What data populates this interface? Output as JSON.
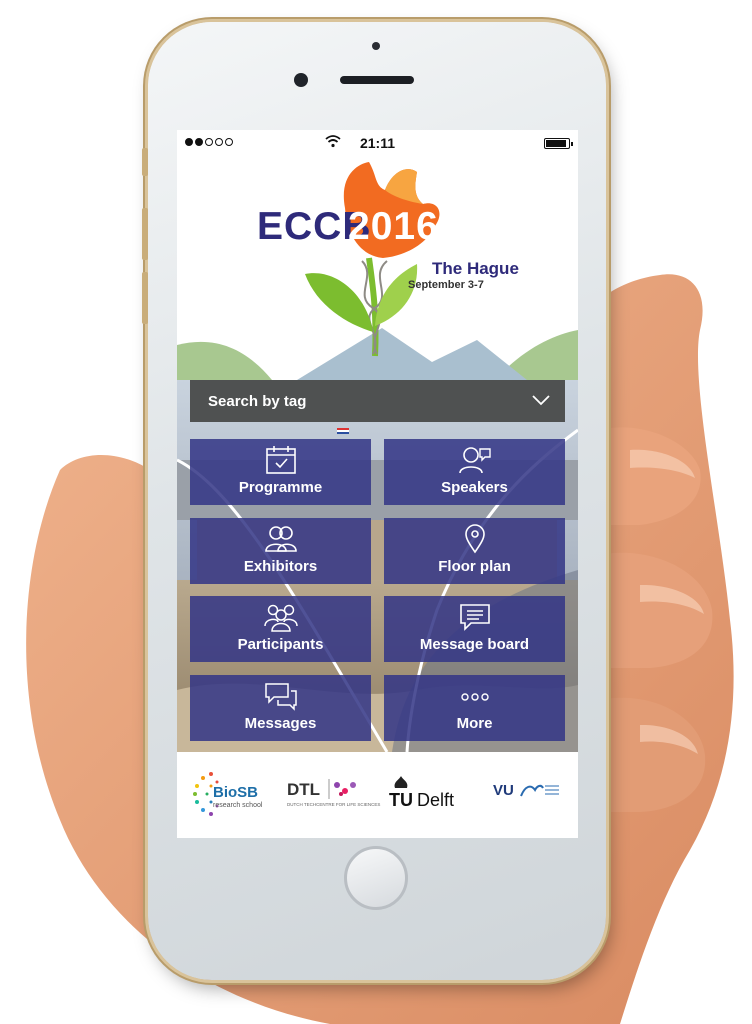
{
  "status_bar": {
    "time": "21:11"
  },
  "event": {
    "name": "ECCB",
    "year": "2016",
    "city": "The Hague",
    "dates": "September 3-7"
  },
  "search": {
    "label": "Search by tag"
  },
  "tiles": [
    {
      "label": "Programme",
      "icon": "calendar-icon"
    },
    {
      "label": "Speakers",
      "icon": "speakers-icon"
    },
    {
      "label": "Exhibitors",
      "icon": "exhibitors-icon"
    },
    {
      "label": "Floor plan",
      "icon": "map-pin-icon"
    },
    {
      "label": "Participants",
      "icon": "participants-icon"
    },
    {
      "label": "Message board",
      "icon": "message-board-icon"
    },
    {
      "label": "Messages",
      "icon": "messages-icon"
    },
    {
      "label": "More",
      "icon": "more-icon"
    }
  ],
  "sponsors": {
    "biosb": {
      "name": "BioSB",
      "tagline": "research school"
    },
    "dtl": {
      "name": "DTL",
      "tagline": "DUTCH TECHCENTRE FOR LIFE SCIENCES"
    },
    "tudelft": {
      "prefix": "TU",
      "name": "Delft"
    },
    "vu": {
      "name": "VU"
    }
  },
  "colors": {
    "tile": "#333686",
    "brand_navy": "#2e2a7a",
    "tulip_orange": "#f26b21",
    "stem_green": "#7cbd2f",
    "search_bar": "#4f5151"
  }
}
